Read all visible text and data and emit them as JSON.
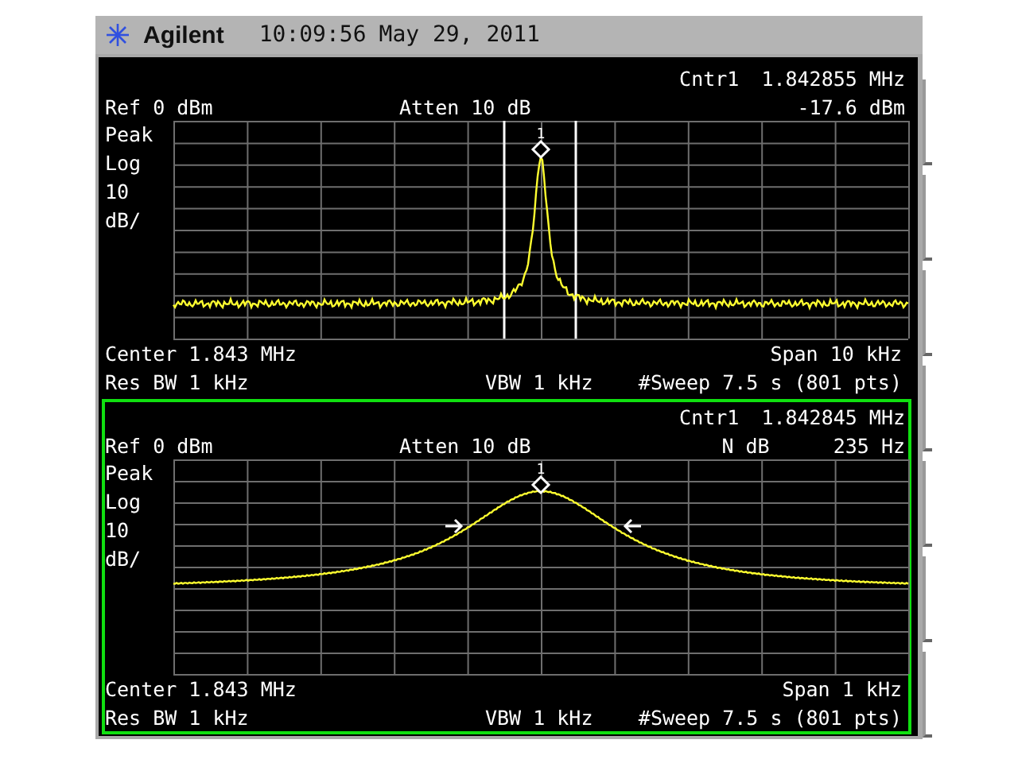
{
  "title_bar": {
    "brand": "Agilent",
    "time": "10:09:56",
    "date": "May 29, 2011"
  },
  "panels": [
    {
      "active": false,
      "kind": "peak",
      "marker": {
        "name": "Cntr1",
        "frequency": "1.842855 MHz",
        "number": "1"
      },
      "ref": "Ref 0 dBm",
      "atten": "Atten 10 dB",
      "readouts": [
        "-17.6 dBm"
      ],
      "scale_labels": [
        "Peak",
        "Log",
        "10",
        "dB/"
      ],
      "center": "Center 1.843 MHz",
      "span": "Span 10 kHz",
      "res_bw": "Res BW 1 kHz",
      "vbw": "VBW 1 kHz",
      "sweep": "#Sweep 7.5 s (801 pts)"
    },
    {
      "active": true,
      "kind": "ndb",
      "marker": {
        "name": "Cntr1",
        "frequency": "1.842845 MHz",
        "number": "1"
      },
      "ref": "Ref 0 dBm",
      "atten": "Atten 10 dB",
      "readouts": [
        "N dB",
        "235 Hz"
      ],
      "scale_labels": [
        "Peak",
        "Log",
        "10",
        "dB/"
      ],
      "center": "Center 1.843 MHz",
      "span": "Span 1 kHz",
      "res_bw": "Res BW 1 kHz",
      "vbw": "VBW 1 kHz",
      "sweep": "#Sweep 7.5 s (801 pts)"
    }
  ]
}
